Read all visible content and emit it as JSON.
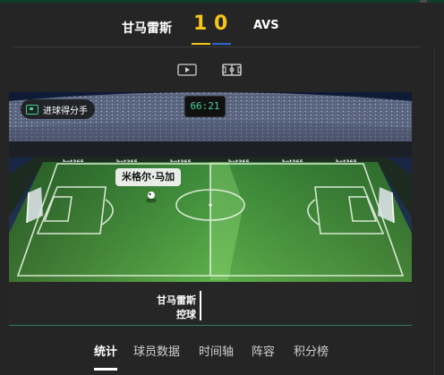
{
  "match": {
    "home_team": "甘马雷斯",
    "away_team": "AVS",
    "home_score": "1",
    "away_score": "0",
    "home_color": "#f5c518",
    "away_color": "#2f64c9"
  },
  "view_modes": {
    "video_icon": "play-video-icon",
    "pitch_icon": "pitch-view-icon",
    "active": "pitch"
  },
  "pitch": {
    "event_label": "进球得分手",
    "clock": "66:21",
    "player_name": "米格尔·马加",
    "sponsor": "bet365"
  },
  "event": {
    "team": "甘马雷斯",
    "action": "控球"
  },
  "tabs": [
    {
      "label": "统计",
      "active": true
    },
    {
      "label": "球员数据",
      "active": false
    },
    {
      "label": "时间轴",
      "active": false
    },
    {
      "label": "阵容",
      "active": false
    },
    {
      "label": "积分榜",
      "active": false
    }
  ]
}
